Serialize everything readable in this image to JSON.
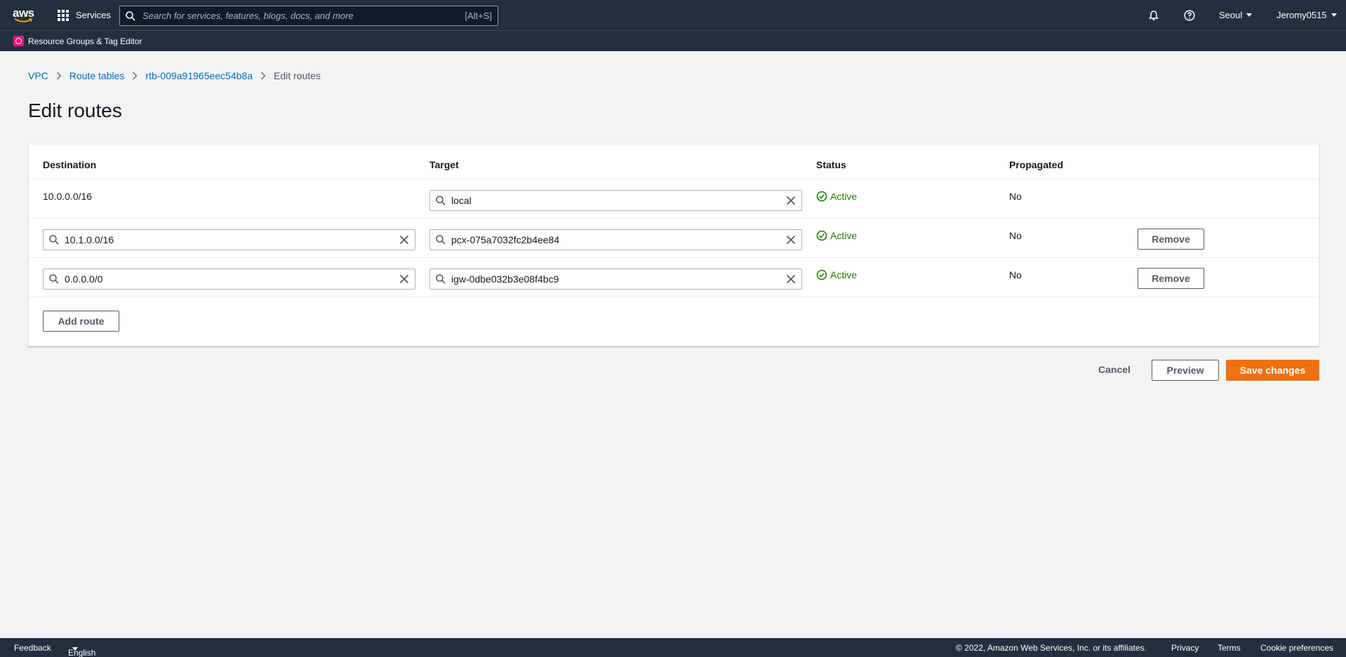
{
  "topnav": {
    "logo_text": "aws",
    "services_label": "Services",
    "search_placeholder": "Search for services, features, blogs, docs, and more",
    "search_shortcut": "[Alt+S]",
    "region": "Seoul",
    "account": "Jeromy0515"
  },
  "subnav": {
    "favorite_label": "Resource Groups & Tag Editor"
  },
  "breadcrumb": {
    "items": [
      "VPC",
      "Route tables",
      "rtb-009a91965eec54b8a"
    ],
    "current": "Edit routes"
  },
  "page_title": "Edit routes",
  "table": {
    "headers": {
      "destination": "Destination",
      "target": "Target",
      "status": "Status",
      "propagated": "Propagated"
    },
    "rows": [
      {
        "destination": "10.0.0.0/16",
        "target": "local",
        "status": "Active",
        "propagated": "No"
      },
      {
        "destination": "10.1.0.0/16",
        "target": "pcx-075a7032fc2b4ee84",
        "status": "Active",
        "propagated": "No",
        "remove_label": "Remove"
      },
      {
        "destination": "0.0.0.0/0",
        "target": "igw-0dbe032b3e08f4bc9",
        "status": "Active",
        "propagated": "No",
        "remove_label": "Remove"
      }
    ],
    "add_route_label": "Add route"
  },
  "actions": {
    "cancel": "Cancel",
    "preview": "Preview",
    "save": "Save changes"
  },
  "footer": {
    "feedback": "Feedback",
    "language": "English (US)",
    "copyright": "© 2022, Amazon Web Services, Inc. or its affiliates.",
    "privacy": "Privacy",
    "terms": "Terms",
    "cookies": "Cookie preferences"
  },
  "colors": {
    "nav_bg": "#232f3e",
    "accent": "#ec7211",
    "link": "#0073bb",
    "success": "#1d8102"
  }
}
